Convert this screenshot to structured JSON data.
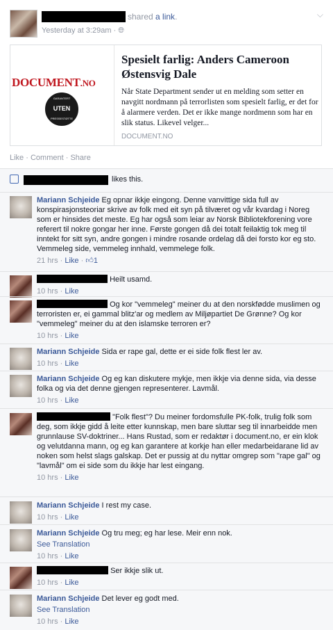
{
  "post": {
    "shared_prefix": "shared",
    "shared_link": "a link",
    "shared_suffix": ".",
    "time": "Yesterday at 3:29am",
    "privacy_separator": "·",
    "privacy_icon": "globe-icon",
    "menu_icon": "chevron-down-icon"
  },
  "card": {
    "logo_main": "DOCUMENT",
    "logo_suffix": ".NO",
    "seal_top": "GARANTERT",
    "seal_main": "UTEN",
    "seal_bottom": "PRESSESTØTTE",
    "title": "Spesielt farlig: Anders Cameroon Østensvig Dale",
    "description": "Når State Department sender ut en melding som setter en navgitt nordmann på terrorlisten som spesielt farlig, er det for å alarmere verden. Det er ikke mange nordmenn som har en slik status. Likevel velger...",
    "domain": "DOCUMENT.NO"
  },
  "actions": {
    "like": "Like",
    "comment": "Comment",
    "share": "Share",
    "separator": "·"
  },
  "likes": {
    "text": "likes this.",
    "icon": "thumbs-up-icon"
  },
  "comments": [
    {
      "author": "Mariann Schjeide",
      "text": "Eg opnar ikkje eingong. Denne vanvittige sida full av konspirasjonsteoriar skrive av folk med eit syn på tilværet og vår kvardag i Noreg som er hinsides det meste. Eg har også som leiar av Norsk Bibliotekforening vore referert til nokre gongar her inne. Første gongen då dei totalt feilaktig tok meg til inntekt for sitt syn, andre gongen i mindre rosande ordelag då dei forsto kor eg sto. Vemmeleg side, vemmeleg innhald, vemmelege folk.",
      "time": "21 hrs",
      "like": "Like",
      "like_count": "1",
      "see_translation": ""
    },
    {
      "author": "",
      "text": "Heilt usamd.",
      "time": "10 hrs",
      "like": "Like"
    },
    {
      "author": "",
      "text": "Og kor \"vemmeleg\" meiner du at den norskfødde muslimen og terroristen er, ei gammal blitz'ar og medlem av Miljøpartiet De Grønne? Og kor \"vemmeleg\" meiner du at den islamske terroren er?",
      "time": "10 hrs",
      "like": "Like"
    },
    {
      "author": "Mariann Schjeide",
      "text": "Sida er rape gal, dette er ei side folk flest ler av.",
      "time": "10 hrs",
      "like": "Like"
    },
    {
      "author": "Mariann Schjeide",
      "text": "Og eg kan diskutere mykje, men ikkje via denne sida, via desse folka og via det denne gjengen representerer. Lavmål.",
      "time": "10 hrs",
      "like": "Like"
    },
    {
      "author": "",
      "text": "\"Folk flest\"? Du meiner fordomsfulle PK-folk, trulig folk som deg, som ikkje gidd å leite etter kunnskap, men bare sluttar seg til innarbeidde men grunnlause SV-doktriner... Hans Rustad, som er redaktør i document.no, er ein klok og velutdanna mann, og eg kan garantere at korkje han eller medarbeidarane lid av noken som helst slags galskap. Det er pussig at du nyttar omgrep som \"rape gal\" og \"lavmål\" om ei side som du ikkje har lest eingang.",
      "time": "10 hrs",
      "like": "Like"
    },
    {
      "author": "Mariann Schjeide",
      "text": "I rest my case.",
      "time": "10 hrs",
      "like": "Like"
    },
    {
      "author": "Mariann Schjeide",
      "text": "Og tru meg; eg har lese. Meir enn nok.",
      "time": "10 hrs",
      "like": "Like",
      "see_translation": "See Translation"
    },
    {
      "author": "",
      "text": "Ser ikkje slik ut.",
      "time": "10 hrs",
      "like": "Like"
    },
    {
      "author": "Mariann Schjeide",
      "text": "Det lever eg godt med.",
      "time": "10 hrs",
      "like": "Like",
      "see_translation": "See Translation"
    }
  ]
}
